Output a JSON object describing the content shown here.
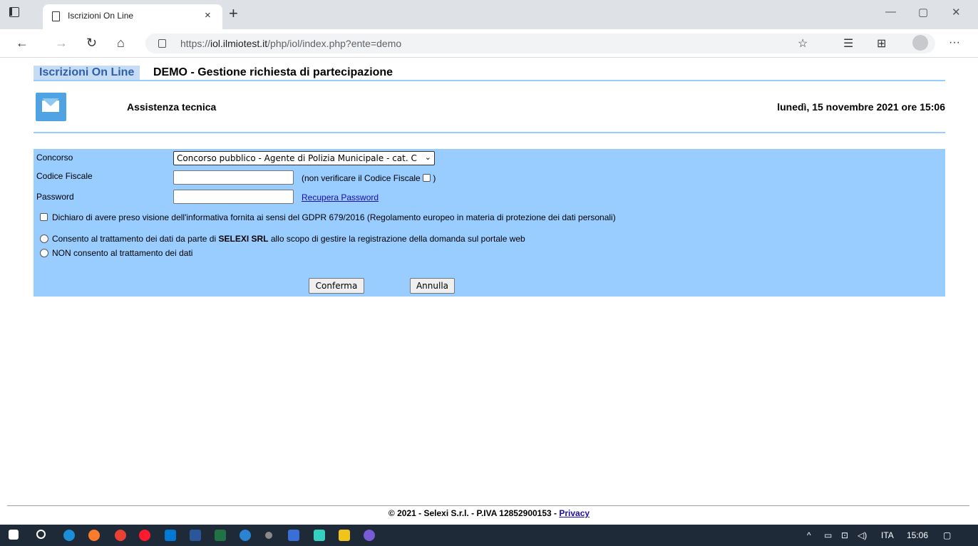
{
  "browser": {
    "tab_title": "Iscrizioni On Line",
    "tab_close": "×",
    "new_tab": "+",
    "url_prefix": "https://",
    "url_host": "iol.ilmiotest.it",
    "url_path": "/php/iol/index.php?ente=demo",
    "window_controls": {
      "minimize": "—",
      "maximize": "▢",
      "close": "✕"
    },
    "icons": [
      "back-icon",
      "forward-icon",
      "refresh-icon",
      "home-icon",
      "lock-icon",
      "favorite-add-icon",
      "favorites-icon",
      "collections-icon",
      "profile-icon",
      "more-icon"
    ],
    "more": "···"
  },
  "header": {
    "brand": "Iscrizioni On Line",
    "title": "DEMO - Gestione richiesta di partecipazione"
  },
  "assistance": {
    "label": "Assistenza tecnica"
  },
  "datetime": "lunedì, 15 novembre 2021 ore 15:06",
  "form": {
    "concorso_label": "Concorso",
    "concorso_selected": "Concorso pubblico - Agente di Polizia Municipale - cat. C",
    "cf_label": "Codice Fiscale",
    "cf_value": "",
    "cf_note_before": "(non verificare il Codice Fiscale",
    "cf_note_after": ")",
    "password_label": "Password",
    "password_value": "",
    "recover_password": "Recupera Password",
    "gdpr_text": "Dichiaro di avere preso visione dell'informativa fornita ai sensi del GDPR 679/2016 (Regolamento europeo in materia di protezione dei dati personali)",
    "consent_prefix": "Consento al trattamento dei dati da parte di ",
    "consent_company": "SELEXI SRL",
    "consent_suffix": " allo scopo di gestire la registrazione della domanda sul portale web",
    "no_consent": "NON consento al trattamento dei dati",
    "confirm_button": "Conferma",
    "cancel_button": "Annulla"
  },
  "footer": {
    "text": "© 2021 - Selexi S.r.l. - P.IVA 12852900153 - ",
    "privacy": "Privacy"
  },
  "taskbar": {
    "language": "ITA",
    "time": "15:06",
    "apps": [
      "windows-start-icon",
      "search-icon",
      "edge-icon",
      "firefox-icon",
      "chrome-icon",
      "opera-icon",
      "outlook-icon",
      "word-icon",
      "excel-icon",
      "app-icon",
      "app-icon",
      "file-manager-icon",
      "snip-icon",
      "paint-icon",
      "php-icon"
    ]
  },
  "colors": {
    "accent": "#99ccff",
    "brand_bg": "#c6dcf5",
    "brand_text": "#2f5ea8",
    "link": "#1a0dab"
  }
}
